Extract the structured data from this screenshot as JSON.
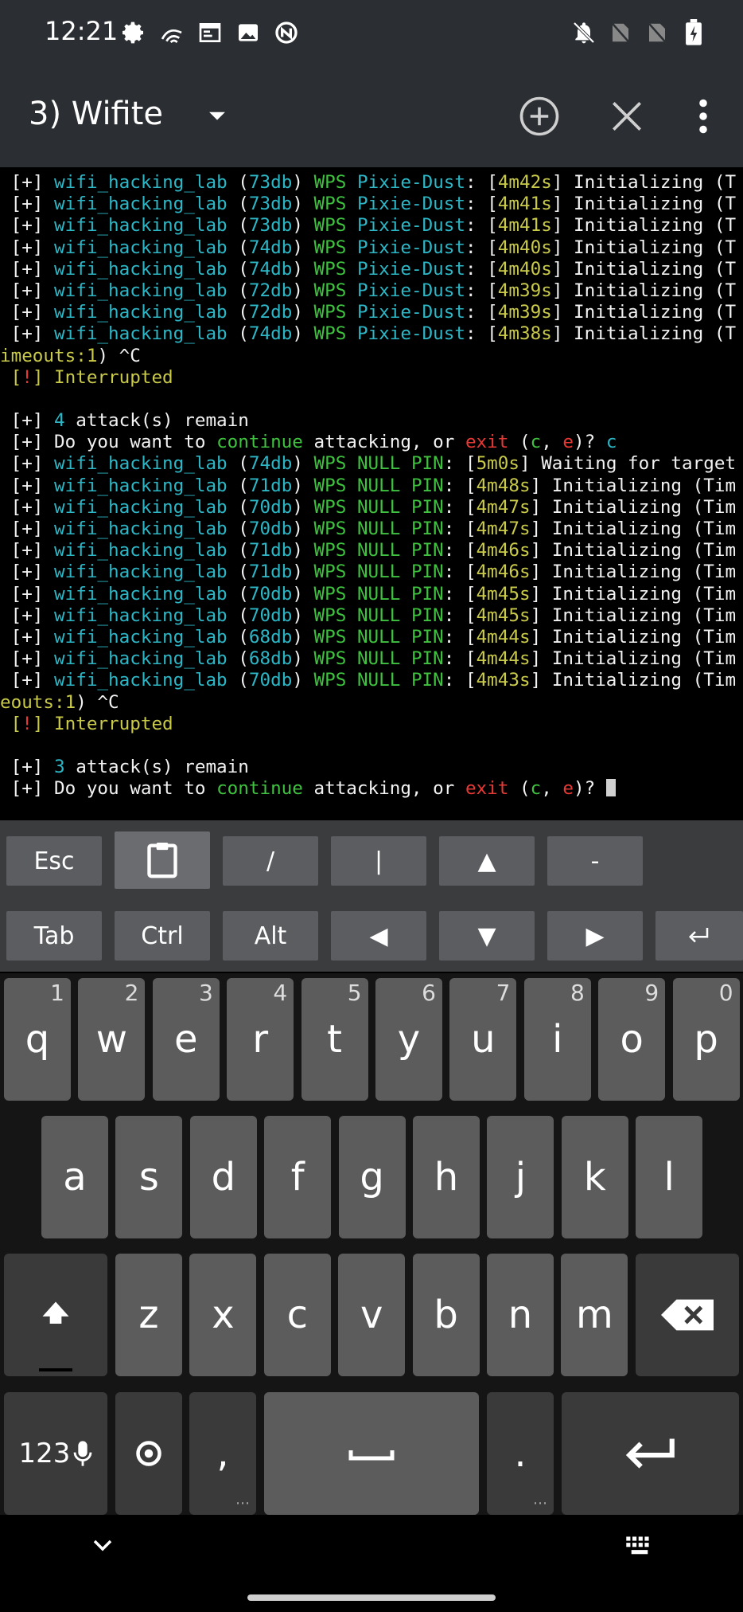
{
  "status_bar": {
    "time": "12:21",
    "left_icons": [
      "gear-icon",
      "signal-waves-icon",
      "terminal-icon",
      "image-icon",
      "nfc-icon"
    ],
    "right_icons": [
      "bell-off-icon",
      "no-signal-icon",
      "no-signal-icon",
      "battery-charging-icon"
    ]
  },
  "app_bar": {
    "session_title": "3) Wifite",
    "icons": [
      "dropdown-icon",
      "add-icon",
      "close-icon",
      "more-icon"
    ]
  },
  "colors": {
    "white": "#f2f2f2",
    "red": "#e53935",
    "cyan": "#2db7c6",
    "green": "#3fc23f",
    "yellow": "#c9c94a",
    "toolbar_bg": "#2b2f33",
    "key_bg": "#5c5c5c"
  },
  "terminal": {
    "lines": [
      [
        {
          "t": " [",
          "c": "white"
        },
        {
          "t": "+",
          "c": "white"
        },
        {
          "t": "] ",
          "c": "white"
        },
        {
          "t": "wifi_hacking_lab",
          "c": "cyan"
        },
        {
          "t": " (",
          "c": "white"
        },
        {
          "t": "73db",
          "c": "cyan"
        },
        {
          "t": ") ",
          "c": "white"
        },
        {
          "t": "WPS",
          "c": "green"
        },
        {
          "t": " ",
          "c": "white"
        },
        {
          "t": "Pixie-Dust",
          "c": "cyan"
        },
        {
          "t": ": [",
          "c": "white"
        },
        {
          "t": "4m42s",
          "c": "yellow"
        },
        {
          "t": "] Initializing (T",
          "c": "white"
        }
      ],
      [
        {
          "t": " [+] ",
          "c": "white"
        },
        {
          "t": "wifi_hacking_lab",
          "c": "cyan"
        },
        {
          "t": " (",
          "c": "white"
        },
        {
          "t": "73db",
          "c": "cyan"
        },
        {
          "t": ") ",
          "c": "white"
        },
        {
          "t": "WPS",
          "c": "green"
        },
        {
          "t": " ",
          "c": "white"
        },
        {
          "t": "Pixie-Dust",
          "c": "cyan"
        },
        {
          "t": ": [",
          "c": "white"
        },
        {
          "t": "4m41s",
          "c": "yellow"
        },
        {
          "t": "] Initializing (T",
          "c": "white"
        }
      ],
      [
        {
          "t": " [+] ",
          "c": "white"
        },
        {
          "t": "wifi_hacking_lab",
          "c": "cyan"
        },
        {
          "t": " (",
          "c": "white"
        },
        {
          "t": "73db",
          "c": "cyan"
        },
        {
          "t": ") ",
          "c": "white"
        },
        {
          "t": "WPS",
          "c": "green"
        },
        {
          "t": " ",
          "c": "white"
        },
        {
          "t": "Pixie-Dust",
          "c": "cyan"
        },
        {
          "t": ": [",
          "c": "white"
        },
        {
          "t": "4m41s",
          "c": "yellow"
        },
        {
          "t": "] Initializing (T",
          "c": "white"
        }
      ],
      [
        {
          "t": " [+] ",
          "c": "white"
        },
        {
          "t": "wifi_hacking_lab",
          "c": "cyan"
        },
        {
          "t": " (",
          "c": "white"
        },
        {
          "t": "74db",
          "c": "cyan"
        },
        {
          "t": ") ",
          "c": "white"
        },
        {
          "t": "WPS",
          "c": "green"
        },
        {
          "t": " ",
          "c": "white"
        },
        {
          "t": "Pixie-Dust",
          "c": "cyan"
        },
        {
          "t": ": [",
          "c": "white"
        },
        {
          "t": "4m40s",
          "c": "yellow"
        },
        {
          "t": "] Initializing (T",
          "c": "white"
        }
      ],
      [
        {
          "t": " [+] ",
          "c": "white"
        },
        {
          "t": "wifi_hacking_lab",
          "c": "cyan"
        },
        {
          "t": " (",
          "c": "white"
        },
        {
          "t": "74db",
          "c": "cyan"
        },
        {
          "t": ") ",
          "c": "white"
        },
        {
          "t": "WPS",
          "c": "green"
        },
        {
          "t": " ",
          "c": "white"
        },
        {
          "t": "Pixie-Dust",
          "c": "cyan"
        },
        {
          "t": ": [",
          "c": "white"
        },
        {
          "t": "4m40s",
          "c": "yellow"
        },
        {
          "t": "] Initializing (T",
          "c": "white"
        }
      ],
      [
        {
          "t": " [+] ",
          "c": "white"
        },
        {
          "t": "wifi_hacking_lab",
          "c": "cyan"
        },
        {
          "t": " (",
          "c": "white"
        },
        {
          "t": "72db",
          "c": "cyan"
        },
        {
          "t": ") ",
          "c": "white"
        },
        {
          "t": "WPS",
          "c": "green"
        },
        {
          "t": " ",
          "c": "white"
        },
        {
          "t": "Pixie-Dust",
          "c": "cyan"
        },
        {
          "t": ": [",
          "c": "white"
        },
        {
          "t": "4m39s",
          "c": "yellow"
        },
        {
          "t": "] Initializing (T",
          "c": "white"
        }
      ],
      [
        {
          "t": " [+] ",
          "c": "white"
        },
        {
          "t": "wifi_hacking_lab",
          "c": "cyan"
        },
        {
          "t": " (",
          "c": "white"
        },
        {
          "t": "72db",
          "c": "cyan"
        },
        {
          "t": ") ",
          "c": "white"
        },
        {
          "t": "WPS",
          "c": "green"
        },
        {
          "t": " ",
          "c": "white"
        },
        {
          "t": "Pixie-Dust",
          "c": "cyan"
        },
        {
          "t": ": [",
          "c": "white"
        },
        {
          "t": "4m39s",
          "c": "yellow"
        },
        {
          "t": "] Initializing (T",
          "c": "white"
        }
      ],
      [
        {
          "t": " [+] ",
          "c": "white"
        },
        {
          "t": "wifi_hacking_lab",
          "c": "cyan"
        },
        {
          "t": " (",
          "c": "white"
        },
        {
          "t": "74db",
          "c": "cyan"
        },
        {
          "t": ") ",
          "c": "white"
        },
        {
          "t": "WPS",
          "c": "green"
        },
        {
          "t": " ",
          "c": "white"
        },
        {
          "t": "Pixie-Dust",
          "c": "cyan"
        },
        {
          "t": ": [",
          "c": "white"
        },
        {
          "t": "4m38s",
          "c": "yellow"
        },
        {
          "t": "] Initializing (T",
          "c": "white"
        }
      ],
      [
        {
          "t": "imeouts:1",
          "c": "yellow"
        },
        {
          "t": ") ^C",
          "c": "white"
        }
      ],
      [
        {
          "t": " [",
          "c": "yellow"
        },
        {
          "t": "!",
          "c": "red"
        },
        {
          "t": "] Interrupted",
          "c": "yellow"
        }
      ],
      [
        {
          "t": "",
          "c": "white"
        }
      ],
      [
        {
          "t": " [+] ",
          "c": "white"
        },
        {
          "t": "4",
          "c": "cyan"
        },
        {
          "t": " attack(s) remain",
          "c": "white"
        }
      ],
      [
        {
          "t": " [+] Do you want to ",
          "c": "white"
        },
        {
          "t": "continue",
          "c": "green"
        },
        {
          "t": " attacking, or ",
          "c": "white"
        },
        {
          "t": "exit",
          "c": "red"
        },
        {
          "t": " (",
          "c": "white"
        },
        {
          "t": "c",
          "c": "green"
        },
        {
          "t": ", ",
          "c": "white"
        },
        {
          "t": "e",
          "c": "red"
        },
        {
          "t": ")? ",
          "c": "white"
        },
        {
          "t": "c",
          "c": "cyan"
        }
      ],
      [
        {
          "t": " [+] ",
          "c": "white"
        },
        {
          "t": "wifi_hacking_lab",
          "c": "cyan"
        },
        {
          "t": " (",
          "c": "white"
        },
        {
          "t": "74db",
          "c": "cyan"
        },
        {
          "t": ") ",
          "c": "white"
        },
        {
          "t": "WPS NULL PIN",
          "c": "green"
        },
        {
          "t": ": [",
          "c": "white"
        },
        {
          "t": "5m0s",
          "c": "yellow"
        },
        {
          "t": "] Waiting for target",
          "c": "white"
        }
      ],
      [
        {
          "t": " [+] ",
          "c": "white"
        },
        {
          "t": "wifi_hacking_lab",
          "c": "cyan"
        },
        {
          "t": " (",
          "c": "white"
        },
        {
          "t": "71db",
          "c": "cyan"
        },
        {
          "t": ") ",
          "c": "white"
        },
        {
          "t": "WPS NULL PIN",
          "c": "green"
        },
        {
          "t": ": [",
          "c": "white"
        },
        {
          "t": "4m48s",
          "c": "yellow"
        },
        {
          "t": "] Initializing (Tim",
          "c": "white"
        }
      ],
      [
        {
          "t": " [+] ",
          "c": "white"
        },
        {
          "t": "wifi_hacking_lab",
          "c": "cyan"
        },
        {
          "t": " (",
          "c": "white"
        },
        {
          "t": "70db",
          "c": "cyan"
        },
        {
          "t": ") ",
          "c": "white"
        },
        {
          "t": "WPS NULL PIN",
          "c": "green"
        },
        {
          "t": ": [",
          "c": "white"
        },
        {
          "t": "4m47s",
          "c": "yellow"
        },
        {
          "t": "] Initializing (Tim",
          "c": "white"
        }
      ],
      [
        {
          "t": " [+] ",
          "c": "white"
        },
        {
          "t": "wifi_hacking_lab",
          "c": "cyan"
        },
        {
          "t": " (",
          "c": "white"
        },
        {
          "t": "70db",
          "c": "cyan"
        },
        {
          "t": ") ",
          "c": "white"
        },
        {
          "t": "WPS NULL PIN",
          "c": "green"
        },
        {
          "t": ": [",
          "c": "white"
        },
        {
          "t": "4m47s",
          "c": "yellow"
        },
        {
          "t": "] Initializing (Tim",
          "c": "white"
        }
      ],
      [
        {
          "t": " [+] ",
          "c": "white"
        },
        {
          "t": "wifi_hacking_lab",
          "c": "cyan"
        },
        {
          "t": " (",
          "c": "white"
        },
        {
          "t": "71db",
          "c": "cyan"
        },
        {
          "t": ") ",
          "c": "white"
        },
        {
          "t": "WPS NULL PIN",
          "c": "green"
        },
        {
          "t": ": [",
          "c": "white"
        },
        {
          "t": "4m46s",
          "c": "yellow"
        },
        {
          "t": "] Initializing (Tim",
          "c": "white"
        }
      ],
      [
        {
          "t": " [+] ",
          "c": "white"
        },
        {
          "t": "wifi_hacking_lab",
          "c": "cyan"
        },
        {
          "t": " (",
          "c": "white"
        },
        {
          "t": "71db",
          "c": "cyan"
        },
        {
          "t": ") ",
          "c": "white"
        },
        {
          "t": "WPS NULL PIN",
          "c": "green"
        },
        {
          "t": ": [",
          "c": "white"
        },
        {
          "t": "4m46s",
          "c": "yellow"
        },
        {
          "t": "] Initializing (Tim",
          "c": "white"
        }
      ],
      [
        {
          "t": " [+] ",
          "c": "white"
        },
        {
          "t": "wifi_hacking_lab",
          "c": "cyan"
        },
        {
          "t": " (",
          "c": "white"
        },
        {
          "t": "70db",
          "c": "cyan"
        },
        {
          "t": ") ",
          "c": "white"
        },
        {
          "t": "WPS NULL PIN",
          "c": "green"
        },
        {
          "t": ": [",
          "c": "white"
        },
        {
          "t": "4m45s",
          "c": "yellow"
        },
        {
          "t": "] Initializing (Tim",
          "c": "white"
        }
      ],
      [
        {
          "t": " [+] ",
          "c": "white"
        },
        {
          "t": "wifi_hacking_lab",
          "c": "cyan"
        },
        {
          "t": " (",
          "c": "white"
        },
        {
          "t": "70db",
          "c": "cyan"
        },
        {
          "t": ") ",
          "c": "white"
        },
        {
          "t": "WPS NULL PIN",
          "c": "green"
        },
        {
          "t": ": [",
          "c": "white"
        },
        {
          "t": "4m45s",
          "c": "yellow"
        },
        {
          "t": "] Initializing (Tim",
          "c": "white"
        }
      ],
      [
        {
          "t": " [+] ",
          "c": "white"
        },
        {
          "t": "wifi_hacking_lab",
          "c": "cyan"
        },
        {
          "t": " (",
          "c": "white"
        },
        {
          "t": "68db",
          "c": "cyan"
        },
        {
          "t": ") ",
          "c": "white"
        },
        {
          "t": "WPS NULL PIN",
          "c": "green"
        },
        {
          "t": ": [",
          "c": "white"
        },
        {
          "t": "4m44s",
          "c": "yellow"
        },
        {
          "t": "] Initializing (Tim",
          "c": "white"
        }
      ],
      [
        {
          "t": " [+] ",
          "c": "white"
        },
        {
          "t": "wifi_hacking_lab",
          "c": "cyan"
        },
        {
          "t": " (",
          "c": "white"
        },
        {
          "t": "68db",
          "c": "cyan"
        },
        {
          "t": ") ",
          "c": "white"
        },
        {
          "t": "WPS NULL PIN",
          "c": "green"
        },
        {
          "t": ": [",
          "c": "white"
        },
        {
          "t": "4m44s",
          "c": "yellow"
        },
        {
          "t": "] Initializing (Tim",
          "c": "white"
        }
      ],
      [
        {
          "t": " [+] ",
          "c": "white"
        },
        {
          "t": "wifi_hacking_lab",
          "c": "cyan"
        },
        {
          "t": " (",
          "c": "white"
        },
        {
          "t": "70db",
          "c": "cyan"
        },
        {
          "t": ") ",
          "c": "white"
        },
        {
          "t": "WPS NULL PIN",
          "c": "green"
        },
        {
          "t": ": [",
          "c": "white"
        },
        {
          "t": "4m43s",
          "c": "yellow"
        },
        {
          "t": "] Initializing (Tim",
          "c": "white"
        }
      ],
      [
        {
          "t": "eouts:1",
          "c": "yellow"
        },
        {
          "t": ") ^C",
          "c": "white"
        }
      ],
      [
        {
          "t": " [",
          "c": "yellow"
        },
        {
          "t": "!",
          "c": "red"
        },
        {
          "t": "] Interrupted",
          "c": "yellow"
        }
      ],
      [
        {
          "t": "",
          "c": "white"
        }
      ],
      [
        {
          "t": " [+] ",
          "c": "white"
        },
        {
          "t": "3",
          "c": "cyan"
        },
        {
          "t": " attack(s) remain",
          "c": "white"
        }
      ],
      [
        {
          "t": " [+] Do you want to ",
          "c": "white"
        },
        {
          "t": "continue",
          "c": "green"
        },
        {
          "t": " attacking, or ",
          "c": "white"
        },
        {
          "t": "exit",
          "c": "red"
        },
        {
          "t": " (",
          "c": "white"
        },
        {
          "t": "c",
          "c": "green"
        },
        {
          "t": ", ",
          "c": "white"
        },
        {
          "t": "e",
          "c": "red"
        },
        {
          "t": ")? ",
          "c": "white"
        }
      ]
    ]
  },
  "extra_keys": {
    "row1": [
      "Esc",
      "clipboard-icon",
      "/",
      "|",
      "▲",
      "-"
    ],
    "row2": [
      "Tab",
      "Ctrl",
      "Alt",
      "◀",
      "▼",
      "▶",
      "enter-icon"
    ]
  },
  "keyboard": {
    "row1": [
      {
        "k": "q",
        "h": "1"
      },
      {
        "k": "w",
        "h": "2"
      },
      {
        "k": "e",
        "h": "3"
      },
      {
        "k": "r",
        "h": "4"
      },
      {
        "k": "t",
        "h": "5"
      },
      {
        "k": "y",
        "h": "6"
      },
      {
        "k": "u",
        "h": "7"
      },
      {
        "k": "i",
        "h": "8"
      },
      {
        "k": "o",
        "h": "9"
      },
      {
        "k": "p",
        "h": "0"
      }
    ],
    "row2": [
      "a",
      "s",
      "d",
      "f",
      "g",
      "h",
      "j",
      "k",
      "l"
    ],
    "row3": [
      "z",
      "x",
      "c",
      "v",
      "b",
      "n",
      "m"
    ],
    "symbols_label": "123",
    "comma": ",",
    "period": ".",
    "icons": [
      "shift-icon",
      "backspace-icon",
      "mic-icon",
      "settings-icon",
      "space-icon",
      "enter-icon"
    ]
  },
  "nav_bar": {
    "icons": [
      "chevron-down-icon",
      "keyboard-icon"
    ]
  }
}
